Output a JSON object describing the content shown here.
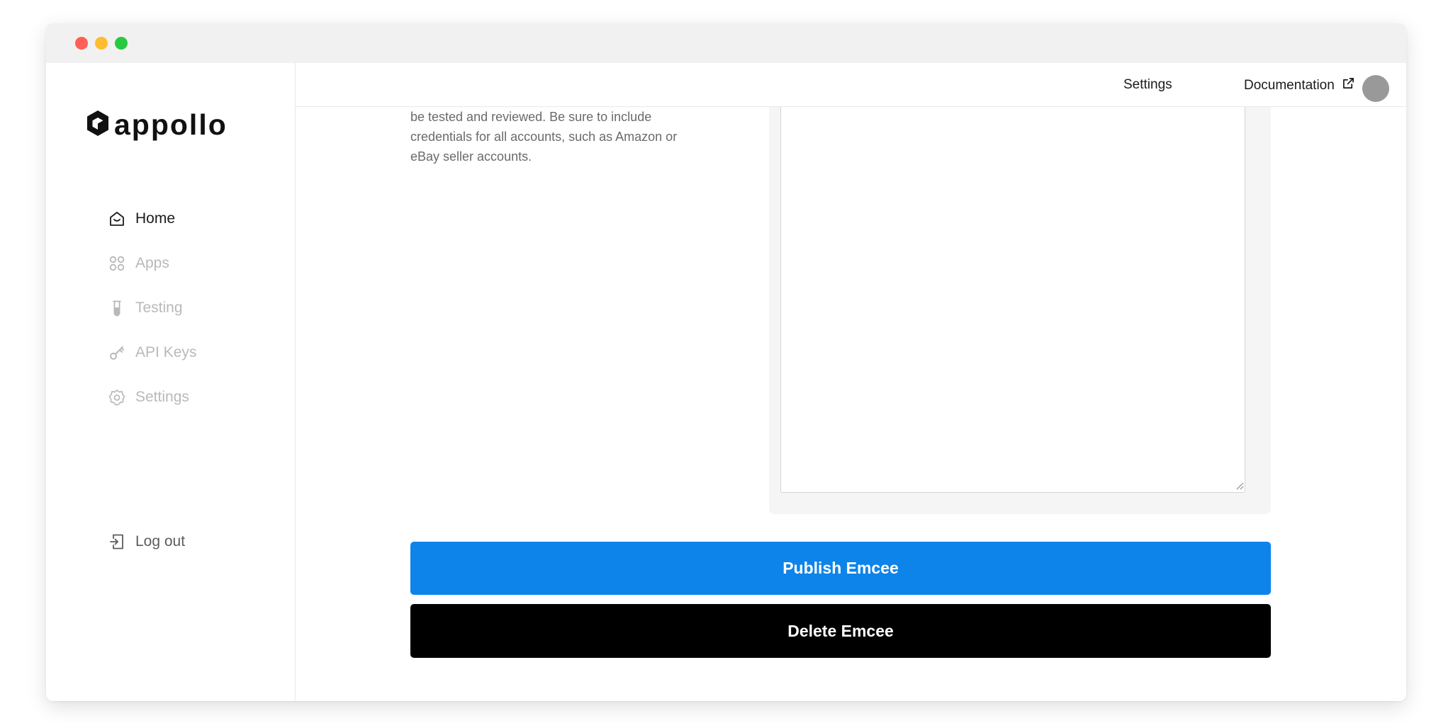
{
  "window": {
    "controls": [
      "close",
      "minimize",
      "maximize"
    ]
  },
  "brand": {
    "name": "appollo",
    "icon": "appollo-logo-icon"
  },
  "sidebar": {
    "items": [
      {
        "label": "Home",
        "icon": "home-icon",
        "active": true
      },
      {
        "label": "Apps",
        "icon": "apps-grid-icon",
        "active": false
      },
      {
        "label": "Testing",
        "icon": "test-tube-icon",
        "active": false
      },
      {
        "label": "API Keys",
        "icon": "key-icon",
        "active": false
      },
      {
        "label": "Settings",
        "icon": "gear-icon",
        "active": false
      }
    ],
    "logout_label": "Log out"
  },
  "header": {
    "settings_label": "Settings",
    "docs_label": "Documentation"
  },
  "form": {
    "description": "be tested and reviewed. Be sure to include credentials for all accounts, such as Amazon or eBay seller accounts.",
    "credentials_value": ""
  },
  "actions": {
    "publish_label": "Publish Emcee",
    "delete_label": "Delete Emcee"
  },
  "colors": {
    "primary": "#0d84ea",
    "danger": "#000000",
    "avatar": "#999999"
  }
}
